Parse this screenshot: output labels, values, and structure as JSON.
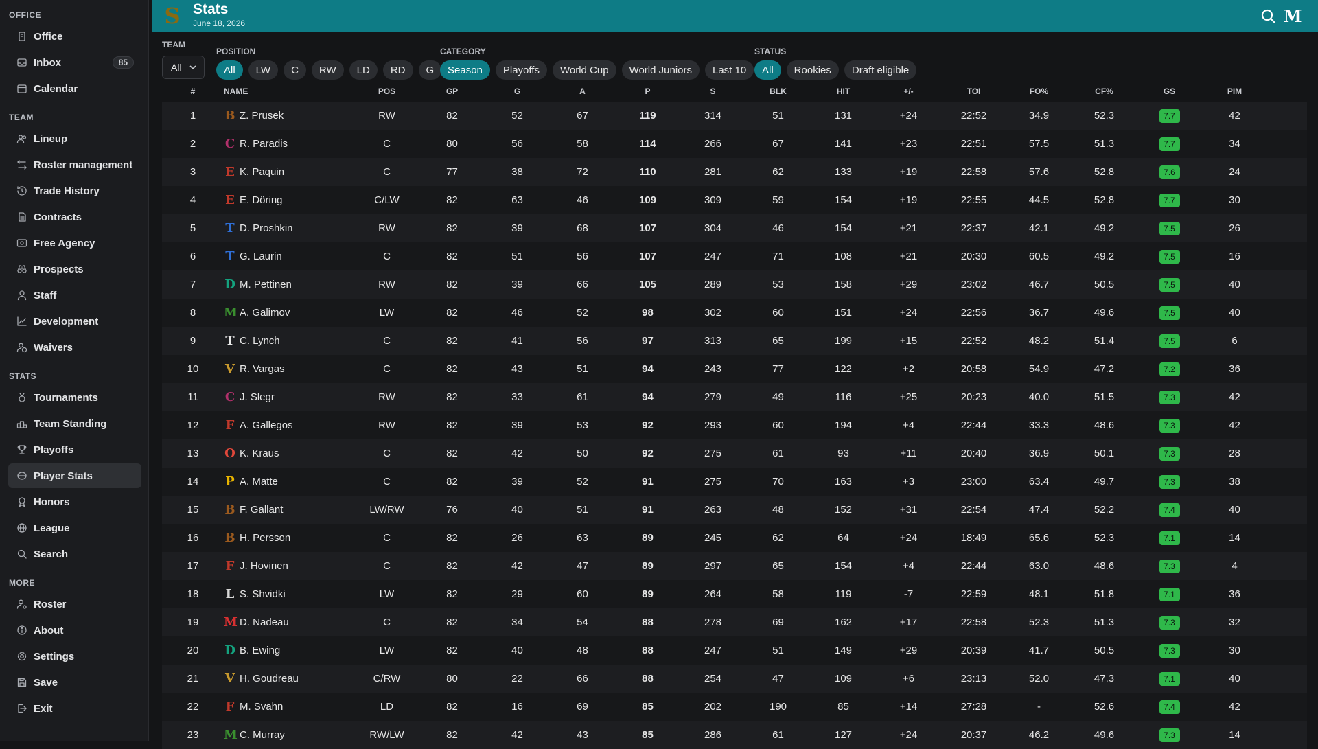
{
  "sidebar": {
    "sections": [
      {
        "title": "OFFICE",
        "items": [
          {
            "label": "Office",
            "icon": "building-icon"
          },
          {
            "label": "Inbox",
            "icon": "inbox-icon",
            "badge": "85"
          },
          {
            "label": "Calendar",
            "icon": "calendar-icon"
          }
        ]
      },
      {
        "title": "TEAM",
        "items": [
          {
            "label": "Lineup",
            "icon": "users-icon"
          },
          {
            "label": "Roster management",
            "icon": "swap-icon"
          },
          {
            "label": "Trade History",
            "icon": "history-icon"
          },
          {
            "label": "Contracts",
            "icon": "contract-icon"
          },
          {
            "label": "Free Agency",
            "icon": "id-card-icon"
          },
          {
            "label": "Prospects",
            "icon": "binoculars-icon"
          },
          {
            "label": "Staff",
            "icon": "staff-icon"
          },
          {
            "label": "Development",
            "icon": "chart-line-icon"
          },
          {
            "label": "Waivers",
            "icon": "user-clock-icon"
          }
        ]
      },
      {
        "title": "STATS",
        "items": [
          {
            "label": "Tournaments",
            "icon": "medal-icon"
          },
          {
            "label": "Team Standing",
            "icon": "podium-icon"
          },
          {
            "label": "Playoffs",
            "icon": "trophy-icon"
          },
          {
            "label": "Player Stats",
            "icon": "stats-icon",
            "active": true
          },
          {
            "label": "Honors",
            "icon": "award-icon"
          },
          {
            "label": "League",
            "icon": "globe-icon"
          },
          {
            "label": "Search",
            "icon": "search-icon"
          }
        ]
      },
      {
        "title": "MORE",
        "items": [
          {
            "label": "Roster",
            "icon": "user-gear-icon"
          },
          {
            "label": "About",
            "icon": "info-icon"
          },
          {
            "label": "Settings",
            "icon": "gear-icon"
          },
          {
            "label": "Save",
            "icon": "save-icon"
          },
          {
            "label": "Exit",
            "icon": "exit-icon"
          }
        ]
      }
    ]
  },
  "header": {
    "logo_letter": "S",
    "title": "Stats",
    "date": "June 18, 2026",
    "menu_letter": "M",
    "color": "#0e7c86"
  },
  "filters": {
    "team_label": "TEAM",
    "team_value": "All",
    "position_label": "POSITION",
    "positions": [
      {
        "label": "All",
        "active": true
      },
      {
        "label": "LW"
      },
      {
        "label": "C"
      },
      {
        "label": "RW"
      },
      {
        "label": "LD"
      },
      {
        "label": "RD"
      },
      {
        "label": "G"
      }
    ],
    "category_label": "CATEGORY",
    "categories": [
      {
        "label": "Season",
        "active": true
      },
      {
        "label": "Playoffs"
      },
      {
        "label": "World Cup"
      },
      {
        "label": "World Juniors"
      },
      {
        "label": "Last 10"
      }
    ],
    "status_label": "STATUS",
    "statuses": [
      {
        "label": "All",
        "active": true
      },
      {
        "label": "Rookies"
      },
      {
        "label": "Draft eligible"
      }
    ]
  },
  "table": {
    "headers": [
      "#",
      "NAME",
      "POS",
      "GP",
      "G",
      "A",
      "P",
      "S",
      "BLK",
      "HIT",
      "+/-",
      "TOI",
      "FO%",
      "CF%",
      "GS",
      "PIM"
    ],
    "rows": [
      {
        "rank": "1",
        "logo": "B",
        "logo_color": "#9b5a1e",
        "name": "Z. Prusek",
        "pos": "RW",
        "gp": "82",
        "g": "52",
        "a": "67",
        "p": "119",
        "s": "314",
        "blk": "51",
        "hit": "131",
        "pm": "+24",
        "toi": "22:52",
        "fo": "34.9",
        "cf": "52.3",
        "gs": "7.7",
        "pim": "42"
      },
      {
        "rank": "2",
        "logo": "C",
        "logo_color": "#b0306a",
        "name": "R. Paradis",
        "pos": "C",
        "gp": "80",
        "g": "56",
        "a": "58",
        "p": "114",
        "s": "266",
        "blk": "67",
        "hit": "141",
        "pm": "+23",
        "toi": "22:51",
        "fo": "57.5",
        "cf": "51.3",
        "gs": "7.7",
        "pim": "34"
      },
      {
        "rank": "3",
        "logo": "E",
        "logo_color": "#c0392b",
        "name": "K. Paquin",
        "pos": "C",
        "gp": "77",
        "g": "38",
        "a": "72",
        "p": "110",
        "s": "281",
        "blk": "62",
        "hit": "133",
        "pm": "+19",
        "toi": "22:58",
        "fo": "57.6",
        "cf": "52.8",
        "gs": "7.6",
        "pim": "24"
      },
      {
        "rank": "4",
        "logo": "E",
        "logo_color": "#c0392b",
        "name": "E. Döring",
        "pos": "C/LW",
        "gp": "82",
        "g": "63",
        "a": "46",
        "p": "109",
        "s": "309",
        "blk": "59",
        "hit": "154",
        "pm": "+19",
        "toi": "22:55",
        "fo": "44.5",
        "cf": "52.8",
        "gs": "7.7",
        "pim": "30"
      },
      {
        "rank": "5",
        "logo": "T",
        "logo_color": "#2f6fd6",
        "name": "D. Proshkin",
        "pos": "RW",
        "gp": "82",
        "g": "39",
        "a": "68",
        "p": "107",
        "s": "304",
        "blk": "46",
        "hit": "154",
        "pm": "+21",
        "toi": "22:37",
        "fo": "42.1",
        "cf": "49.2",
        "gs": "7.5",
        "pim": "26"
      },
      {
        "rank": "6",
        "logo": "T",
        "logo_color": "#2f6fd6",
        "name": "G. Laurin",
        "pos": "C",
        "gp": "82",
        "g": "51",
        "a": "56",
        "p": "107",
        "s": "247",
        "blk": "71",
        "hit": "108",
        "pm": "+21",
        "toi": "20:30",
        "fo": "60.5",
        "cf": "49.2",
        "gs": "7.5",
        "pim": "16"
      },
      {
        "rank": "7",
        "logo": "D",
        "logo_color": "#14a37f",
        "name": "M. Pettinen",
        "pos": "RW",
        "gp": "82",
        "g": "39",
        "a": "66",
        "p": "105",
        "s": "289",
        "blk": "53",
        "hit": "158",
        "pm": "+29",
        "toi": "23:02",
        "fo": "46.7",
        "cf": "50.5",
        "gs": "7.5",
        "pim": "40"
      },
      {
        "rank": "8",
        "logo": "M",
        "logo_color": "#3a8f2f",
        "name": "A. Galimov",
        "pos": "LW",
        "gp": "82",
        "g": "46",
        "a": "52",
        "p": "98",
        "s": "302",
        "blk": "60",
        "hit": "151",
        "pm": "+24",
        "toi": "22:56",
        "fo": "36.7",
        "cf": "49.6",
        "gs": "7.5",
        "pim": "40"
      },
      {
        "rank": "9",
        "logo": "T",
        "logo_color": "#e8e8e8",
        "name": "C. Lynch",
        "pos": "C",
        "gp": "82",
        "g": "41",
        "a": "56",
        "p": "97",
        "s": "313",
        "blk": "65",
        "hit": "199",
        "pm": "+15",
        "toi": "22:52",
        "fo": "48.2",
        "cf": "51.4",
        "gs": "7.5",
        "pim": "6"
      },
      {
        "rank": "10",
        "logo": "V",
        "logo_color": "#c99a2e",
        "name": "R. Vargas",
        "pos": "C",
        "gp": "82",
        "g": "43",
        "a": "51",
        "p": "94",
        "s": "243",
        "blk": "77",
        "hit": "122",
        "pm": "+2",
        "toi": "20:58",
        "fo": "54.9",
        "cf": "47.2",
        "gs": "7.2",
        "pim": "36"
      },
      {
        "rank": "11",
        "logo": "C",
        "logo_color": "#b0306a",
        "name": "J. Slegr",
        "pos": "RW",
        "gp": "82",
        "g": "33",
        "a": "61",
        "p": "94",
        "s": "279",
        "blk": "49",
        "hit": "116",
        "pm": "+25",
        "toi": "20:23",
        "fo": "40.0",
        "cf": "51.5",
        "gs": "7.3",
        "pim": "42"
      },
      {
        "rank": "12",
        "logo": "F",
        "logo_color": "#c0392b",
        "name": "A. Gallegos",
        "pos": "RW",
        "gp": "82",
        "g": "39",
        "a": "53",
        "p": "92",
        "s": "293",
        "blk": "60",
        "hit": "194",
        "pm": "+4",
        "toi": "22:44",
        "fo": "33.3",
        "cf": "48.6",
        "gs": "7.3",
        "pim": "42"
      },
      {
        "rank": "13",
        "logo": "O",
        "logo_color": "#e0473a",
        "name": "K. Kraus",
        "pos": "C",
        "gp": "82",
        "g": "42",
        "a": "50",
        "p": "92",
        "s": "275",
        "blk": "61",
        "hit": "93",
        "pm": "+11",
        "toi": "20:40",
        "fo": "36.9",
        "cf": "50.1",
        "gs": "7.3",
        "pim": "28"
      },
      {
        "rank": "14",
        "logo": "P",
        "logo_color": "#e8b400",
        "name": "A. Matte",
        "pos": "C",
        "gp": "82",
        "g": "39",
        "a": "52",
        "p": "91",
        "s": "275",
        "blk": "70",
        "hit": "163",
        "pm": "+3",
        "toi": "23:00",
        "fo": "63.4",
        "cf": "49.7",
        "gs": "7.3",
        "pim": "38"
      },
      {
        "rank": "15",
        "logo": "B",
        "logo_color": "#9b5a1e",
        "name": "F. Gallant",
        "pos": "LW/RW",
        "gp": "76",
        "g": "40",
        "a": "51",
        "p": "91",
        "s": "263",
        "blk": "48",
        "hit": "152",
        "pm": "+31",
        "toi": "22:54",
        "fo": "47.4",
        "cf": "52.2",
        "gs": "7.4",
        "pim": "40"
      },
      {
        "rank": "16",
        "logo": "B",
        "logo_color": "#9b5a1e",
        "name": "H. Persson",
        "pos": "C",
        "gp": "82",
        "g": "26",
        "a": "63",
        "p": "89",
        "s": "245",
        "blk": "62",
        "hit": "64",
        "pm": "+24",
        "toi": "18:49",
        "fo": "65.6",
        "cf": "52.3",
        "gs": "7.1",
        "pim": "14"
      },
      {
        "rank": "17",
        "logo": "F",
        "logo_color": "#c0392b",
        "name": "J. Hovinen",
        "pos": "C",
        "gp": "82",
        "g": "42",
        "a": "47",
        "p": "89",
        "s": "297",
        "blk": "65",
        "hit": "154",
        "pm": "+4",
        "toi": "22:44",
        "fo": "63.0",
        "cf": "48.6",
        "gs": "7.3",
        "pim": "4"
      },
      {
        "rank": "18",
        "logo": "L",
        "logo_color": "#d8d8d8",
        "name": "S. Shvidki",
        "pos": "LW",
        "gp": "82",
        "g": "29",
        "a": "60",
        "p": "89",
        "s": "264",
        "blk": "58",
        "hit": "119",
        "pm": "-7",
        "toi": "22:59",
        "fo": "48.1",
        "cf": "51.8",
        "gs": "7.1",
        "pim": "36"
      },
      {
        "rank": "19",
        "logo": "M",
        "logo_color": "#d63031",
        "name": "D. Nadeau",
        "pos": "C",
        "gp": "82",
        "g": "34",
        "a": "54",
        "p": "88",
        "s": "278",
        "blk": "69",
        "hit": "162",
        "pm": "+17",
        "toi": "22:58",
        "fo": "52.3",
        "cf": "51.3",
        "gs": "7.3",
        "pim": "32"
      },
      {
        "rank": "20",
        "logo": "D",
        "logo_color": "#14a37f",
        "name": "B. Ewing",
        "pos": "LW",
        "gp": "82",
        "g": "40",
        "a": "48",
        "p": "88",
        "s": "247",
        "blk": "51",
        "hit": "149",
        "pm": "+29",
        "toi": "20:39",
        "fo": "41.7",
        "cf": "50.5",
        "gs": "7.3",
        "pim": "30"
      },
      {
        "rank": "21",
        "logo": "V",
        "logo_color": "#c99a2e",
        "name": "H. Goudreau",
        "pos": "C/RW",
        "gp": "80",
        "g": "22",
        "a": "66",
        "p": "88",
        "s": "254",
        "blk": "47",
        "hit": "109",
        "pm": "+6",
        "toi": "23:13",
        "fo": "52.0",
        "cf": "47.3",
        "gs": "7.1",
        "pim": "40"
      },
      {
        "rank": "22",
        "logo": "F",
        "logo_color": "#c0392b",
        "name": "M. Svahn",
        "pos": "LD",
        "gp": "82",
        "g": "16",
        "a": "69",
        "p": "85",
        "s": "202",
        "blk": "190",
        "hit": "85",
        "pm": "+14",
        "toi": "27:28",
        "fo": "-",
        "cf": "52.6",
        "gs": "7.4",
        "pim": "42"
      },
      {
        "rank": "23",
        "logo": "M",
        "logo_color": "#3a8f2f",
        "name": "C. Murray",
        "pos": "RW/LW",
        "gp": "82",
        "g": "42",
        "a": "43",
        "p": "85",
        "s": "286",
        "blk": "61",
        "hit": "127",
        "pm": "+24",
        "toi": "20:37",
        "fo": "46.2",
        "cf": "49.6",
        "gs": "7.3",
        "pim": "14"
      }
    ]
  }
}
